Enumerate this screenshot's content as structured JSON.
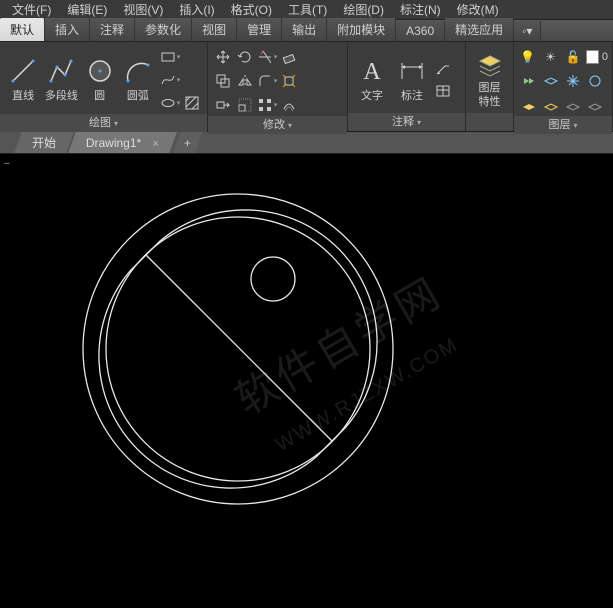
{
  "menubar": {
    "items": [
      {
        "label": "文件(F)"
      },
      {
        "label": "编辑(E)"
      },
      {
        "label": "视图(V)"
      },
      {
        "label": "插入(I)"
      },
      {
        "label": "格式(O)"
      },
      {
        "label": "工具(T)"
      },
      {
        "label": "绘图(D)"
      },
      {
        "label": "标注(N)"
      },
      {
        "label": "修改(M)"
      }
    ]
  },
  "ribbon_tabs": {
    "items": [
      {
        "label": "默认",
        "active": true
      },
      {
        "label": "插入"
      },
      {
        "label": "注释"
      },
      {
        "label": "参数化"
      },
      {
        "label": "视图"
      },
      {
        "label": "管理"
      },
      {
        "label": "输出"
      },
      {
        "label": "附加模块"
      },
      {
        "label": "A360"
      },
      {
        "label": "精选应用"
      }
    ]
  },
  "ribbon": {
    "draw": {
      "title": "绘图",
      "line": "直线",
      "polyline": "多段线",
      "circle": "圆",
      "arc": "圆弧"
    },
    "modify": {
      "title": "修改"
    },
    "annotate": {
      "title": "注释",
      "text": "文字",
      "dim": "标注"
    },
    "layerprops": {
      "title_line1": "图层",
      "title_line2": "特性"
    },
    "layers": {
      "title": "图层"
    }
  },
  "doc_tabs": {
    "start": "开始",
    "drawing": "Drawing1*"
  },
  "watermark": {
    "line1": "软件自学网",
    "line2": "WWW.RJZXW.COM"
  }
}
